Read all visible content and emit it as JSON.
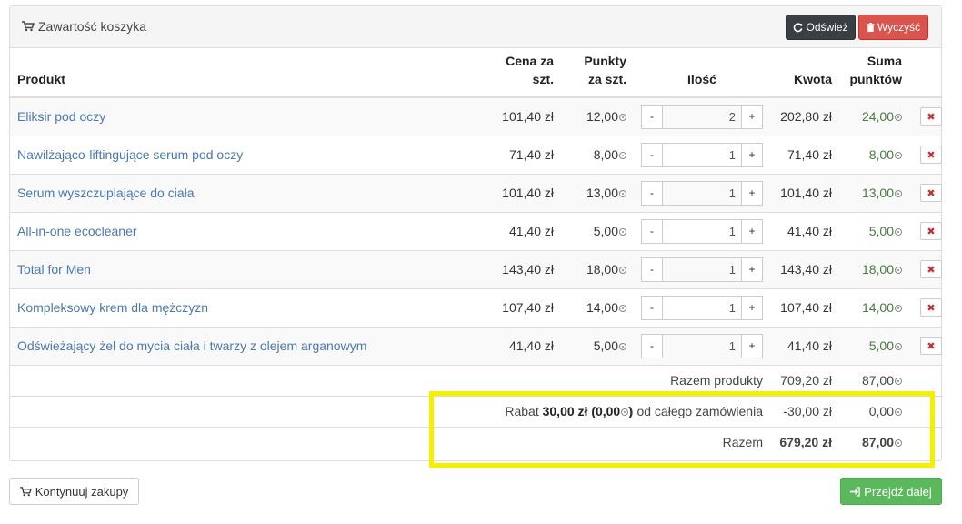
{
  "header": {
    "title": "Zawartość koszyka",
    "refresh_label": "Odśwież",
    "clear_label": "Wyczyść"
  },
  "columns": {
    "product": "Produkt",
    "price_a": "Cena za",
    "price_b": "szt.",
    "points_a": "Punkty",
    "points_b": "za szt.",
    "qty": "Ilość",
    "amount": "Kwota",
    "sum_a": "Suma",
    "sum_b": "punktów"
  },
  "items": [
    {
      "name": "Eliksir pod oczy",
      "price": "101,40 zł",
      "points": "12,00",
      "qty": "2",
      "amount": "202,80 zł",
      "sum_points": "24,00"
    },
    {
      "name": "Nawilżająco-liftingujące serum pod oczy",
      "price": "71,40 zł",
      "points": "8,00",
      "qty": "1",
      "amount": "71,40 zł",
      "sum_points": "8,00"
    },
    {
      "name": "Serum wyszczuplające do ciała",
      "price": "101,40 zł",
      "points": "13,00",
      "qty": "1",
      "amount": "101,40 zł",
      "sum_points": "13,00"
    },
    {
      "name": "All-in-one ecocleaner",
      "price": "41,40 zł",
      "points": "5,00",
      "qty": "1",
      "amount": "41,40 zł",
      "sum_points": "5,00"
    },
    {
      "name": "Total for Men",
      "price": "143,40 zł",
      "points": "18,00",
      "qty": "1",
      "amount": "143,40 zł",
      "sum_points": "18,00"
    },
    {
      "name": "Kompleksowy krem dla mężczyzn",
      "price": "107,40 zł",
      "points": "14,00",
      "qty": "1",
      "amount": "107,40 zł",
      "sum_points": "14,00"
    },
    {
      "name": "Odświeżający żel do mycia ciała i twarzy z olejem arganowym",
      "price": "41,40 zł",
      "points": "5,00",
      "qty": "1",
      "amount": "41,40 zł",
      "sum_points": "5,00"
    }
  ],
  "qty_minus": "-",
  "qty_plus": "+",
  "delete_glyph": "✖",
  "summary": {
    "products_label": "Razem produkty",
    "products_amount": "709,20 zł",
    "products_points": "87,00",
    "discount_prefix": "Rabat",
    "discount_value": "30,00 zł (0,00",
    "discount_suffix": ") od całego zamówienia",
    "discount_amount": "-30,00 zł",
    "discount_points": "0,00",
    "total_label": "Razem",
    "total_amount": "679,20 zł",
    "total_points": "87,00"
  },
  "footer": {
    "continue_label": "Kontynuuj zakupy",
    "next_label": "Przejdź dalej"
  },
  "colors": {
    "highlight": "#f5f000",
    "link": "#4a78b0",
    "danger": "#d9534f",
    "success": "#5cb85c",
    "dark": "#3a3f44"
  }
}
